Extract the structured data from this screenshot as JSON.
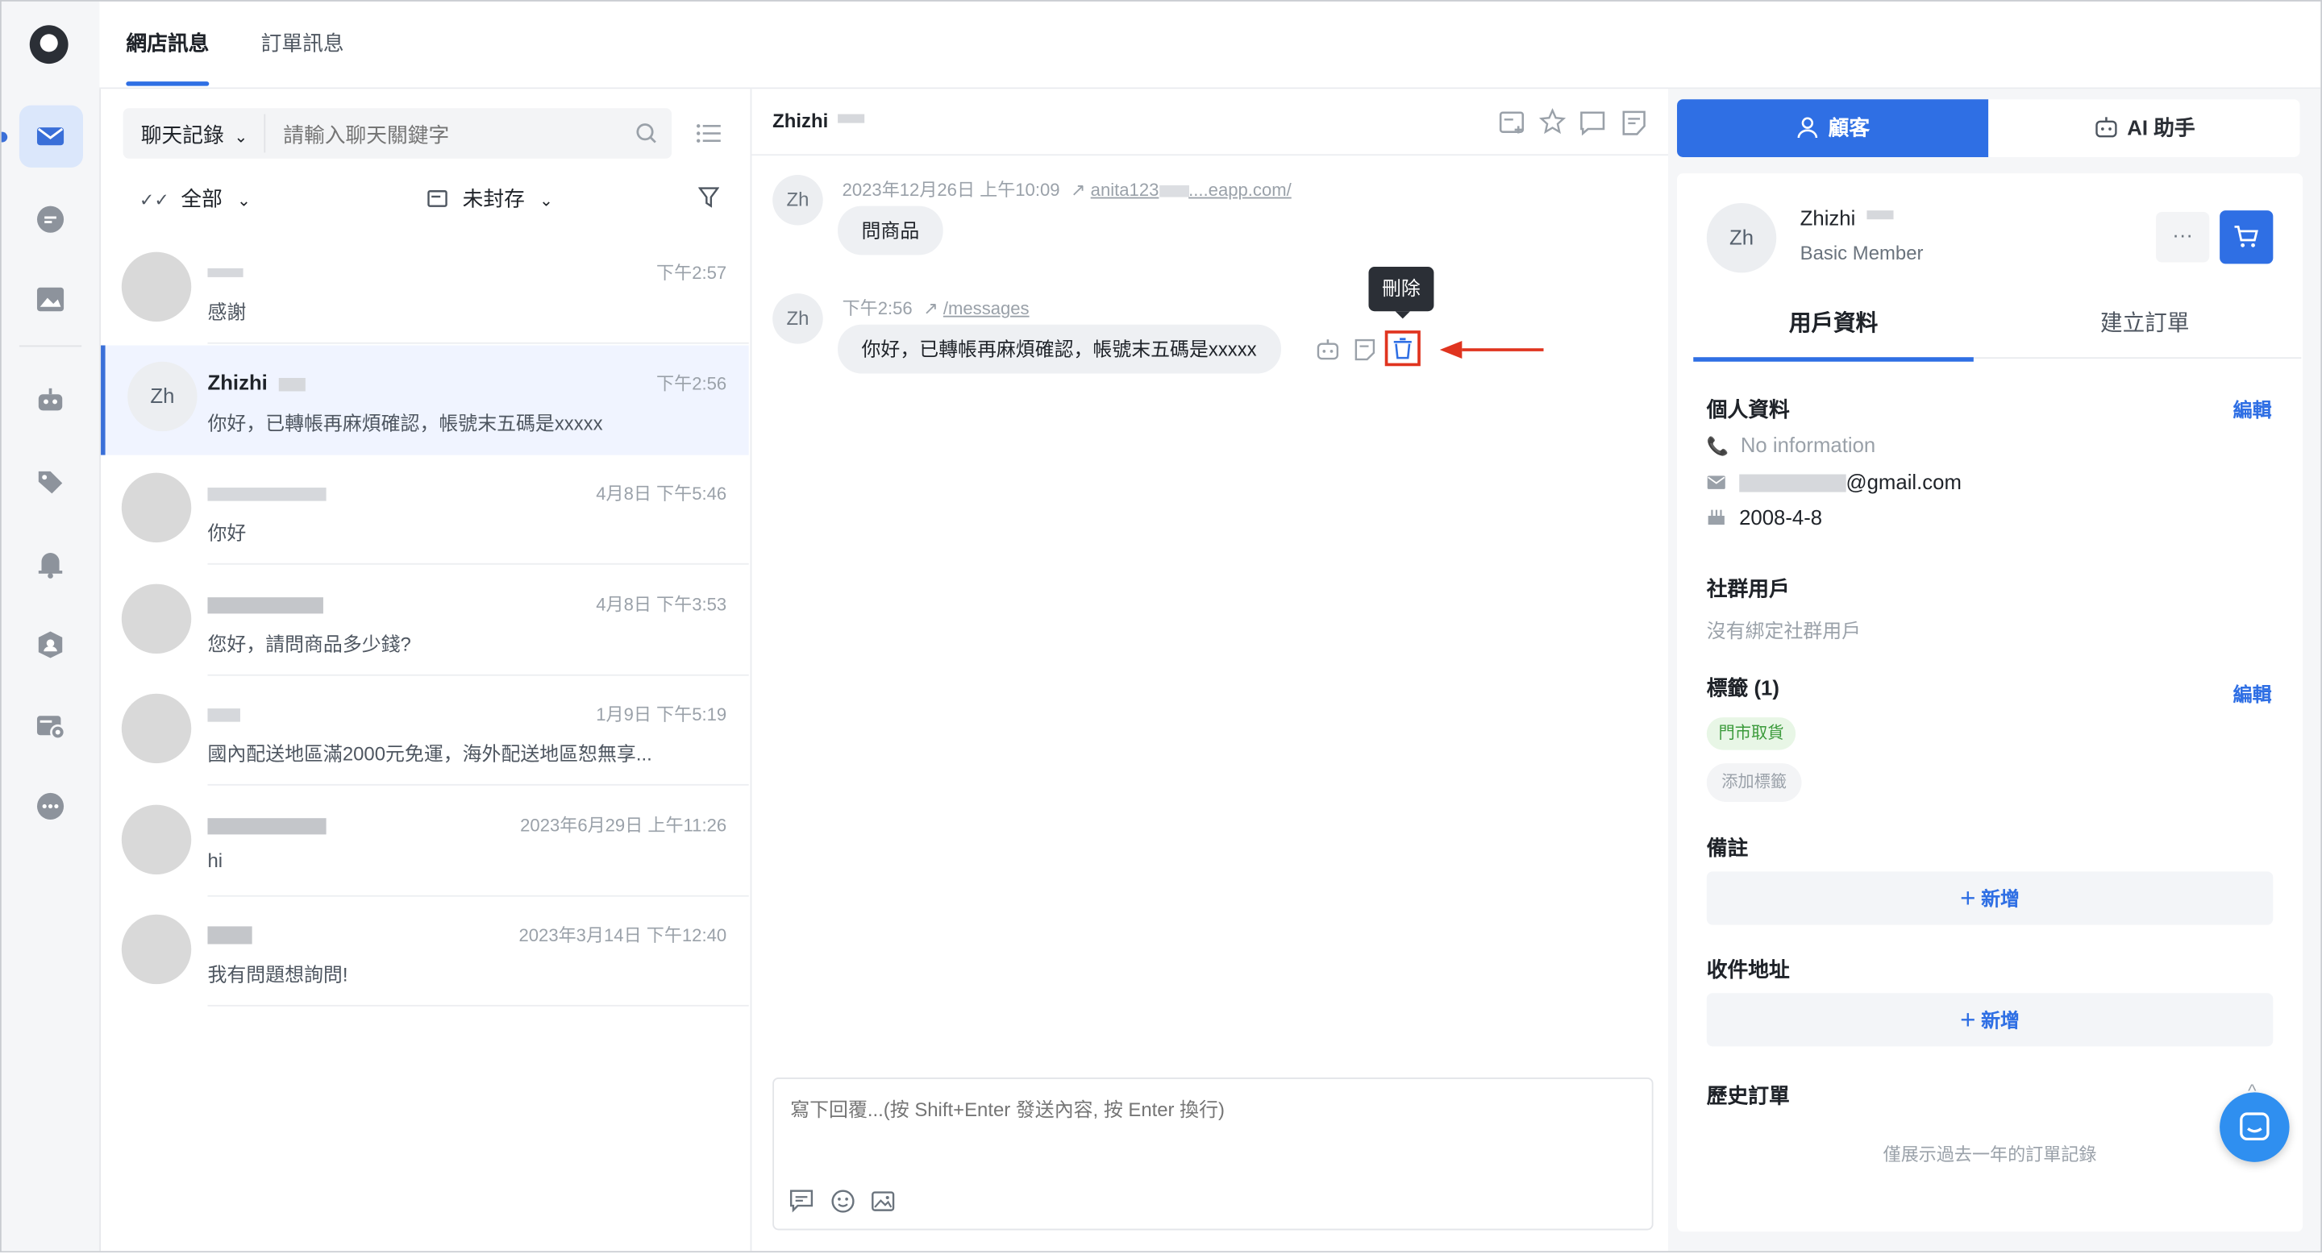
{
  "top_tabs": {
    "shop_messages": "網店訊息",
    "order_messages": "訂單訊息"
  },
  "list": {
    "filter_select": "聊天記錄",
    "search_placeholder": "請輸入聊天關鍵字",
    "filter_all": "全部",
    "filter_status": "未封存",
    "conversations": [
      {
        "name": "",
        "time": "下午2:57",
        "preview": "感謝",
        "avatar": ""
      },
      {
        "name": "Zhizhi",
        "time": "下午2:56",
        "preview": "你好，已轉帳再麻煩確認，帳號末五碼是xxxxx",
        "avatar": "Zh"
      },
      {
        "name": "",
        "time": "4月8日 下午5:46",
        "preview": "你好",
        "avatar": ""
      },
      {
        "name": "",
        "time": "4月8日 下午3:53",
        "preview": "您好，請問商品多少錢?",
        "avatar": ""
      },
      {
        "name": "",
        "time": "1月9日 下午5:19",
        "preview": "國內配送地區滿2000元免運，海外配送地區恕無享...",
        "avatar": ""
      },
      {
        "name": "",
        "time": "2023年6月29日 上午11:26",
        "preview": "hi",
        "avatar": ""
      },
      {
        "name": "",
        "time": "2023年3月14日 下午12:40",
        "preview": "我有問題想詢問!",
        "avatar": ""
      }
    ]
  },
  "chat": {
    "contact_name": "Zhizhi",
    "messages": [
      {
        "avatar": "Zh",
        "time": "2023年12月26日 上午10:09",
        "link": "anita123",
        "link_suffix": "....eapp.com/",
        "text": "問商品"
      },
      {
        "avatar": "Zh",
        "time": "下午2:56",
        "link": "/messages",
        "text": "你好，已轉帳再麻煩確認，帳號末五碼是xxxxx"
      }
    ],
    "tooltip": "刪除",
    "reply_placeholder": "寫下回覆...(按 Shift+Enter 發送內容, 按 Enter 換行)"
  },
  "right": {
    "tab_customer": "顧客",
    "tab_ai": "AI 助手",
    "customer_name": "Zhizhi",
    "membership": "Basic Member",
    "avatar": "Zh",
    "subtab_profile": "用戶資料",
    "subtab_order": "建立訂單",
    "personal_title": "個人資料",
    "edit": "編輯",
    "phone": "No information",
    "email_suffix": "@gmail.com",
    "birthday": "2008-4-8",
    "social_title": "社群用戶",
    "social_empty": "沒有綁定社群用戶",
    "tags_title": "標籤 (1)",
    "tag_1": "門市取貨",
    "add_tag": "添加標籤",
    "notes_title": "備註",
    "add_label": "新增",
    "address_title": "收件地址",
    "history_title": "歷史訂單",
    "history_hint": "僅展示過去一年的訂單記錄"
  },
  "colors": {
    "accent": "#2f6fe4",
    "highlight": "#e0341f",
    "tag_bg": "#e8f6e6",
    "tag_text": "#3a9a3a"
  }
}
